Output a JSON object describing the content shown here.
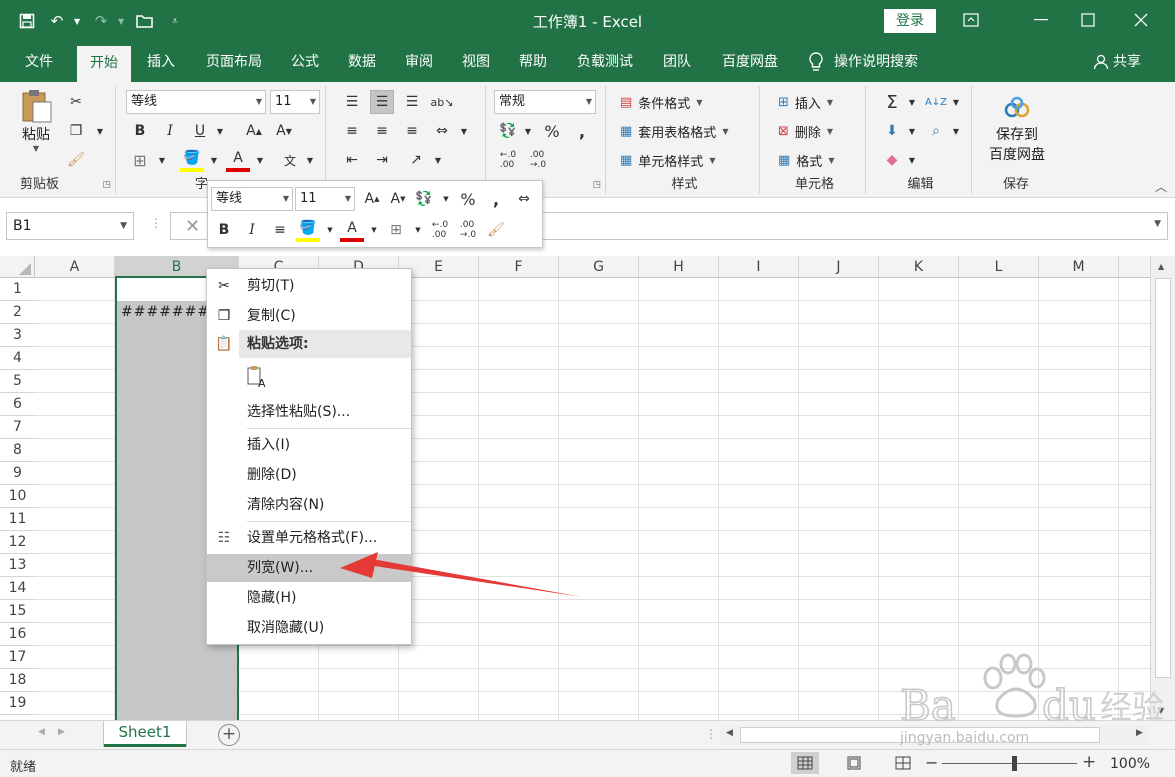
{
  "window": {
    "title": "工作簿1 - Excel",
    "login": "登录"
  },
  "tabs": [
    "文件",
    "开始",
    "插入",
    "页面布局",
    "公式",
    "数据",
    "审阅",
    "视图",
    "帮助",
    "负载测试",
    "团队",
    "百度网盘"
  ],
  "active_tab": "开始",
  "tell_me": "操作说明搜索",
  "share": "共享",
  "ribbon": {
    "clipboard": {
      "paste": "粘贴",
      "label": "剪贴板"
    },
    "font": {
      "name": "等线",
      "size": "11",
      "label": "字"
    },
    "number": {
      "format": "常规"
    },
    "styles": {
      "conditional": "条件格式",
      "table": "套用表格格式",
      "cell": "单元格样式",
      "label": "样式"
    },
    "cells": {
      "insert": "插入",
      "delete": "删除",
      "format": "格式",
      "label": "单元格"
    },
    "editing": {
      "label": "编辑"
    },
    "save": {
      "line1": "保存到",
      "line2": "百度网盘",
      "label": "保存"
    }
  },
  "formula_bar": {
    "name_box": "B1",
    "value": ""
  },
  "columns": [
    "A",
    "B",
    "C",
    "D",
    "E",
    "F",
    "G",
    "H",
    "I",
    "J",
    "K",
    "L",
    "M"
  ],
  "selected_column": "B",
  "rows": [
    "1",
    "2",
    "3",
    "4",
    "5",
    "6",
    "7",
    "8",
    "9",
    "10",
    "11",
    "12",
    "13",
    "14",
    "15",
    "16",
    "17",
    "18",
    "19"
  ],
  "cell_b2": "#########",
  "mini_toolbar": {
    "font": "等线",
    "size": "11"
  },
  "context_menu": {
    "cut": "剪切(T)",
    "copy": "复制(C)",
    "paste_options": "粘贴选项:",
    "paste_special": "选择性粘贴(S)...",
    "insert": "插入(I)",
    "delete": "删除(D)",
    "clear": "清除内容(N)",
    "format_cells": "设置单元格格式(F)...",
    "column_width": "列宽(W)...",
    "hide": "隐藏(H)",
    "unhide": "取消隐藏(U)"
  },
  "sheet_tab": "Sheet1",
  "status": {
    "text": "就绪",
    "zoom": "100%"
  },
  "watermark": {
    "logo": "Baidu经验",
    "url": "jingyan.baidu.com"
  },
  "colors": {
    "excel_green": "#217346",
    "arrow_red": "#e53935"
  }
}
